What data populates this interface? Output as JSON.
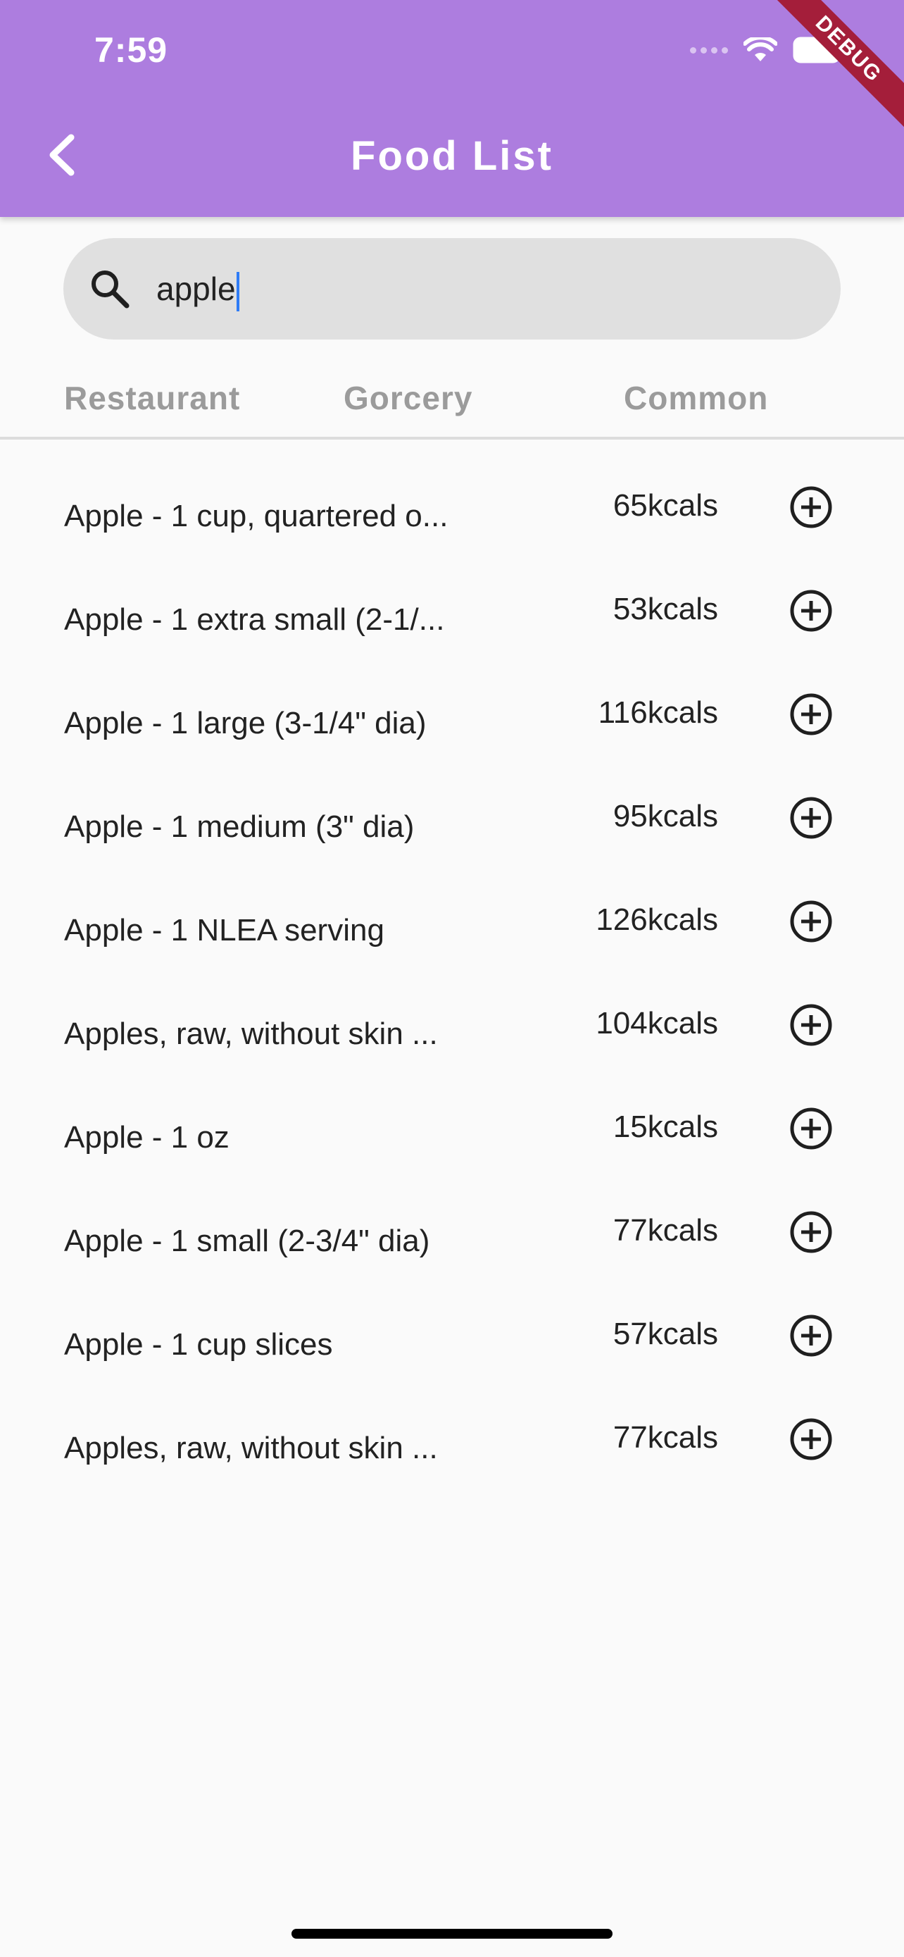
{
  "colors": {
    "app_bar": "#ad7ddf",
    "search_bg": "#e0e0e0",
    "tab_text": "#9b9b9b",
    "debug_banner": "#a41e3a",
    "caret": "#2f7cf6"
  },
  "status_bar": {
    "time": "7:59"
  },
  "debug_banner": "DEBUG",
  "header": {
    "title": "Food List",
    "back_icon": "chevron-left-icon"
  },
  "search": {
    "value": "apple",
    "icon": "search-icon"
  },
  "tabs": [
    {
      "label": "Restaurant"
    },
    {
      "label": "Gorcery"
    },
    {
      "label": "Common"
    }
  ],
  "foods": [
    {
      "name": "Apple - 1 cup, quartered o...",
      "kcals": "65kcals"
    },
    {
      "name": "Apple - 1 extra small (2-1/...",
      "kcals": "53kcals"
    },
    {
      "name": "Apple - 1 large (3-1/4\" dia)",
      "kcals": "116kcals"
    },
    {
      "name": "Apple - 1 medium (3\" dia)",
      "kcals": "95kcals"
    },
    {
      "name": "Apple - 1 NLEA serving",
      "kcals": "126kcals"
    },
    {
      "name": "Apples, raw, without skin ...",
      "kcals": "104kcals"
    },
    {
      "name": "Apple - 1 oz",
      "kcals": "15kcals"
    },
    {
      "name": "Apple - 1 small (2-3/4\" dia)",
      "kcals": "77kcals"
    },
    {
      "name": "Apple - 1 cup slices",
      "kcals": "57kcals"
    },
    {
      "name": "Apples, raw, without skin ...",
      "kcals": "77kcals"
    }
  ]
}
